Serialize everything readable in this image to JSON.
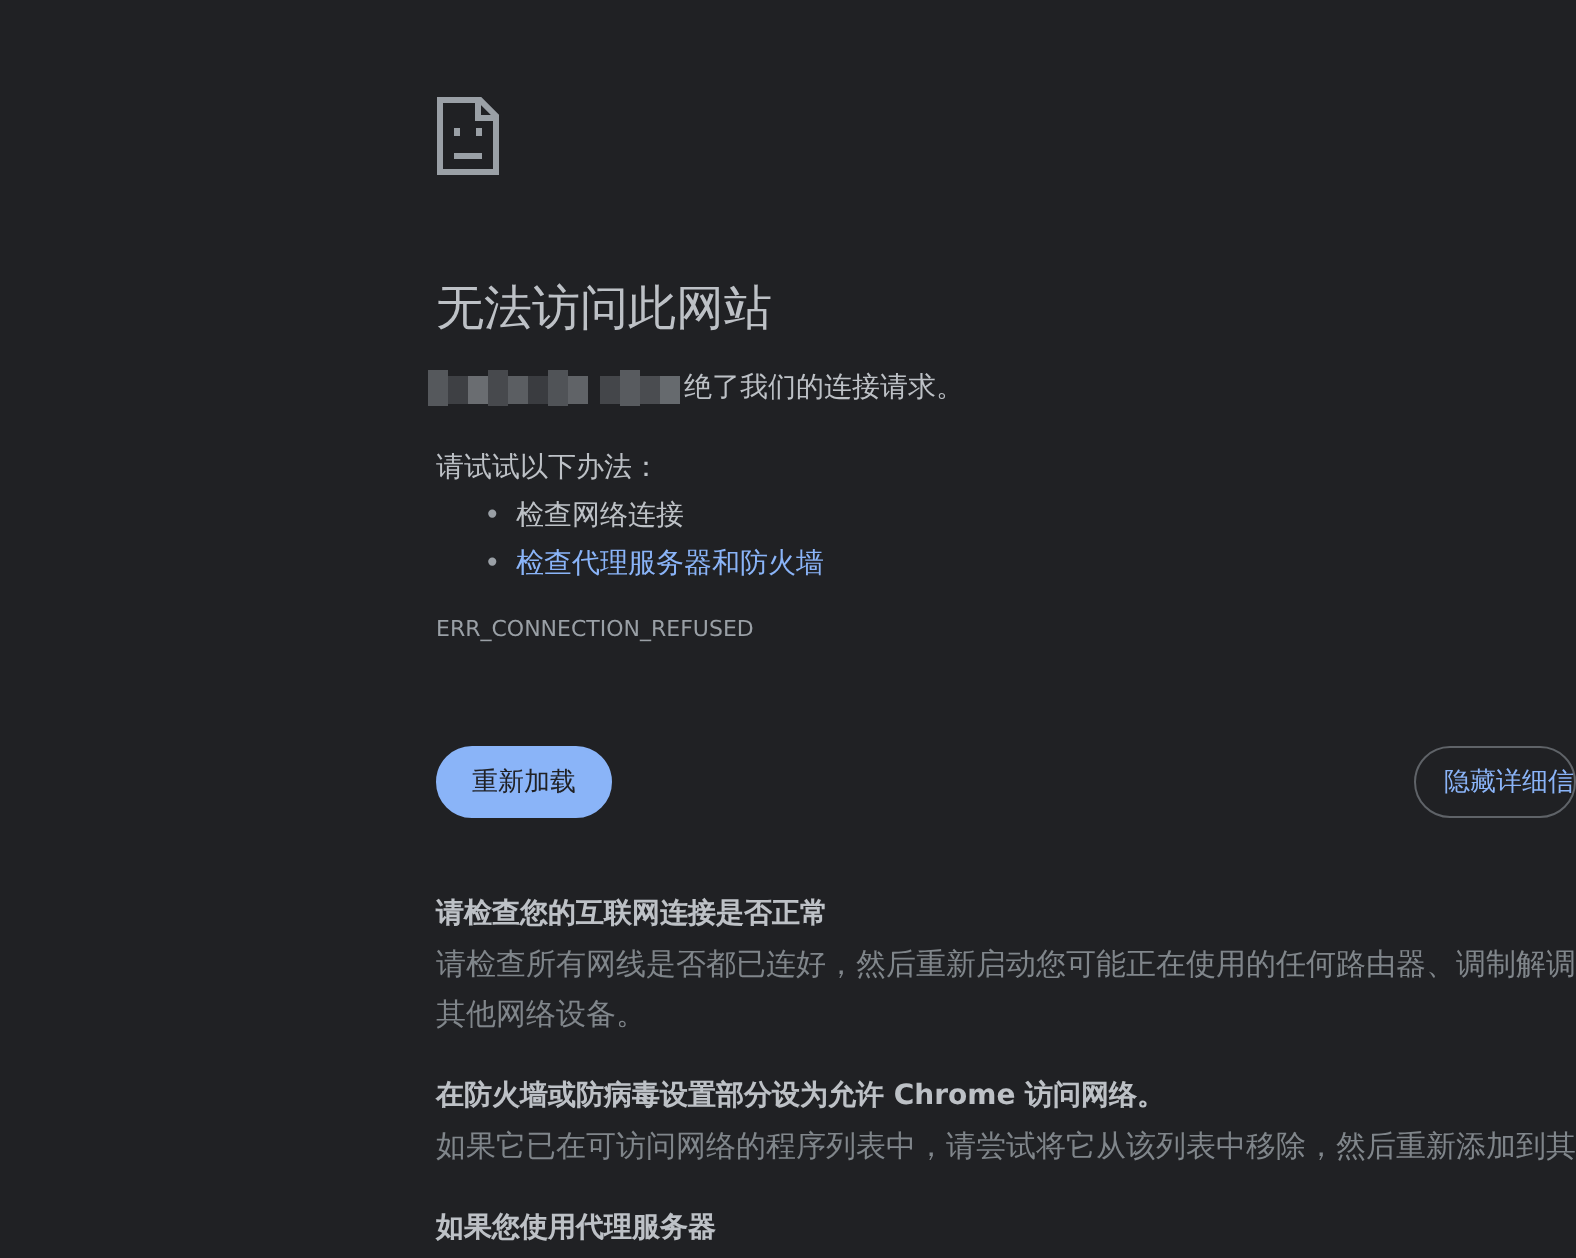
{
  "error_page": {
    "title": "无法访问此网站",
    "message": "绝了我们的连接请求。",
    "suggestions_intro": "请试试以下办法：",
    "suggestions": [
      {
        "kind": "text",
        "bullet": "•",
        "label": "检查网络连接"
      },
      {
        "kind": "link",
        "bullet": "•",
        "label": "检查代理服务器和防火墙"
      }
    ],
    "error_code": "ERR_CONNECTION_REFUSED",
    "buttons": [
      {
        "kind": "primary",
        "label": "重新加载"
      },
      {
        "kind": "outline",
        "label": "隐藏详细信"
      }
    ],
    "details": [
      {
        "heading": "请检查您的互联网连接是否正常",
        "lines": [
          "请检查所有网线是否都已连好，然后重新启动您可能正在使用的任何路由器、调制解调",
          "其他网络设备。"
        ]
      },
      {
        "heading": "在防火墙或防病毒设置部分设为允许 Chrome 访问网络。",
        "lines": [
          "如果它已在可访问网络的程序列表中，请尝试将它从该列表中移除，然后重新添加到其"
        ]
      },
      {
        "heading": "如果您使用代理服务器"
      }
    ]
  }
}
